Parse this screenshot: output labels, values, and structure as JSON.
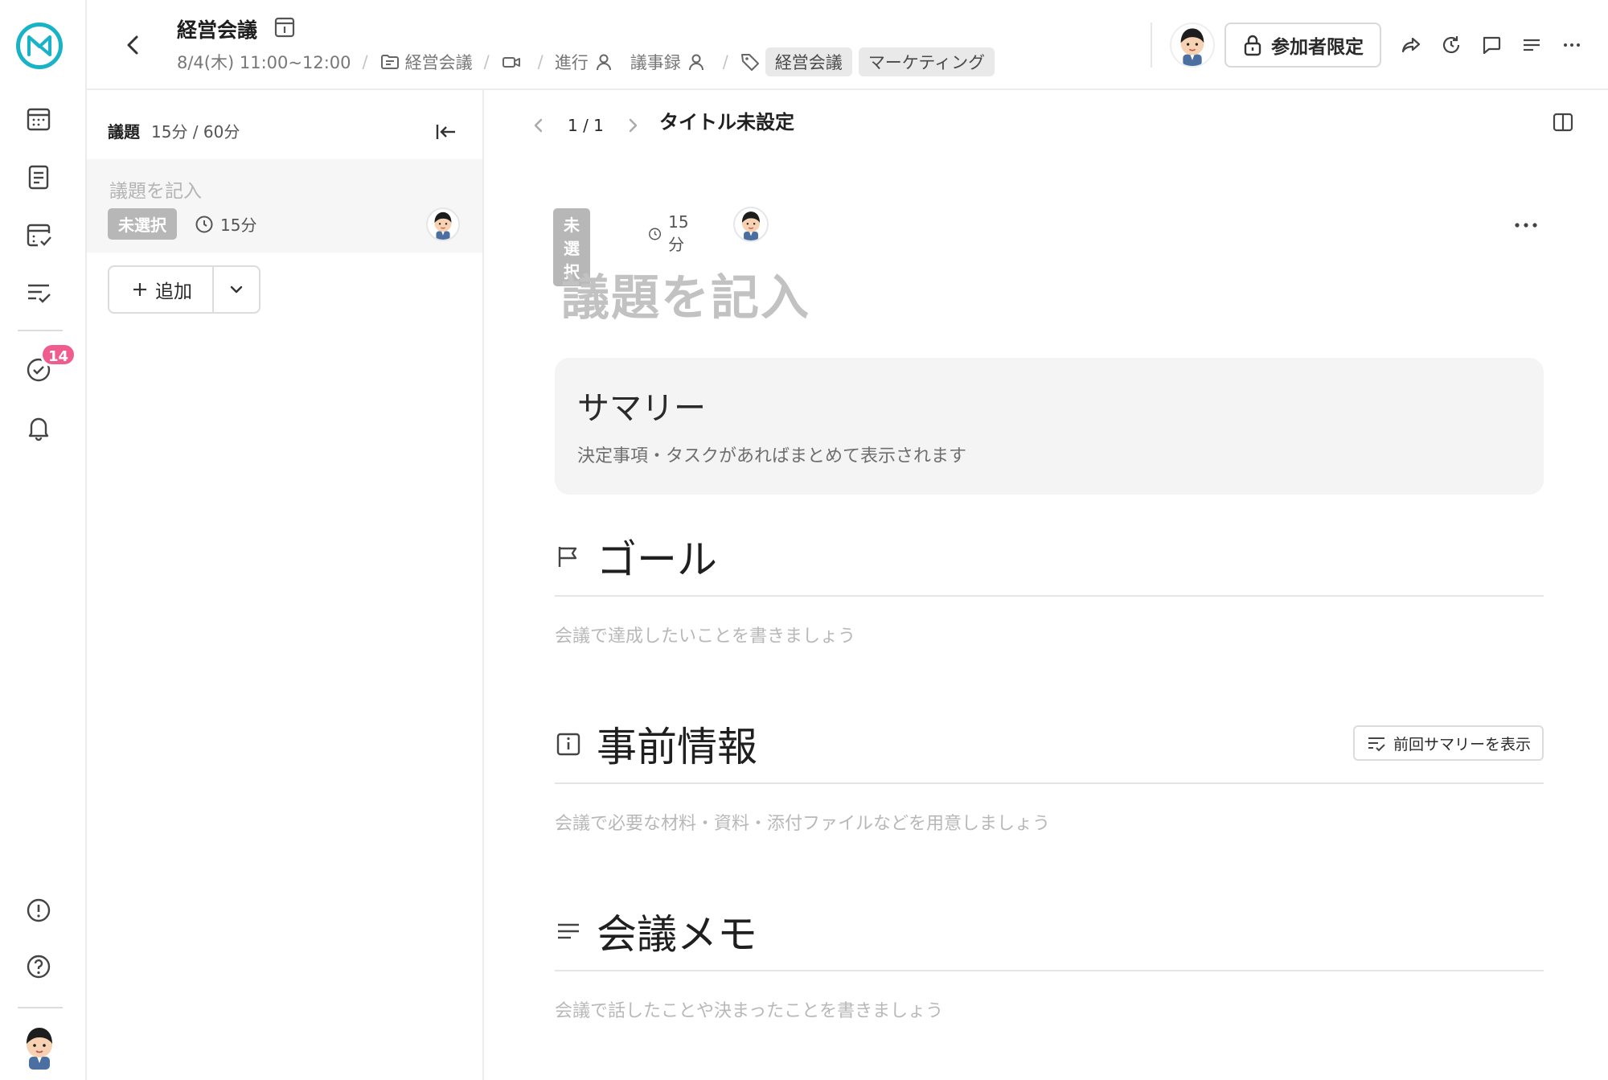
{
  "header": {
    "meeting_title": "経営会議",
    "datetime": "8/4(木) 11:00~12:00",
    "separator": "/",
    "folder": "経営会議",
    "facilitator_label": "進行",
    "minutes_label": "議事録",
    "tags": [
      "経営会議",
      "マーケティング"
    ],
    "access_label": "参加者限定"
  },
  "rail": {
    "notification_count": "14"
  },
  "agenda": {
    "label": "議題",
    "time_summary": "15分 / 60分",
    "items": [
      {
        "title_placeholder": "議題を記入",
        "status": "未選択",
        "duration": "15分"
      }
    ],
    "add_label": "追加"
  },
  "main": {
    "pager": "1 / 1",
    "page_title": "タイトル未設定",
    "topic_status": "未選択",
    "topic_duration": "15分",
    "topic_title_placeholder": "議題を記入",
    "summary": {
      "title": "サマリー",
      "description": "決定事項・タスクがあればまとめて表示されます"
    },
    "sections": {
      "goal": {
        "title": "ゴール",
        "placeholder": "会議で達成したいことを書きましょう"
      },
      "pre_info": {
        "title": "事前情報",
        "placeholder": "会議で必要な材料・資料・添付ファイルなどを用意しましょう",
        "button_label": "前回サマリーを表示"
      },
      "memo": {
        "title": "会議メモ",
        "placeholder": "会議で話したことや決まったことを書きましょう"
      }
    }
  },
  "colors": {
    "brand": "#19b3c8",
    "badge": "#ef5d8f",
    "status_chip": "#b7b7b7"
  }
}
